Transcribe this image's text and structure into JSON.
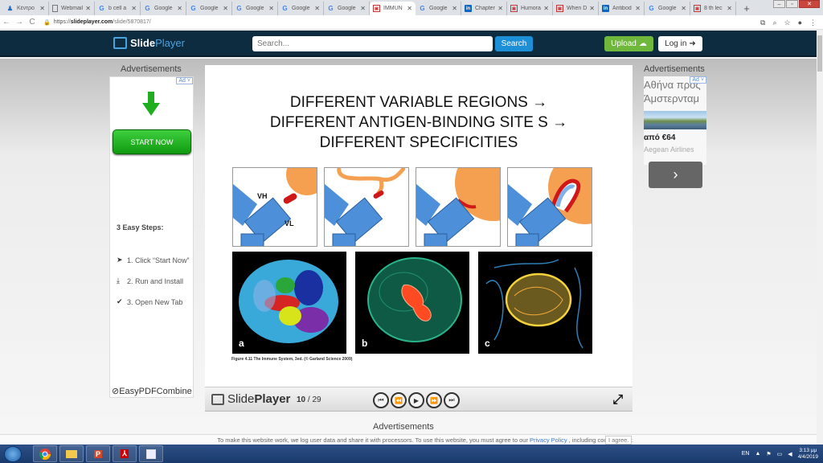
{
  "browser": {
    "tabs": [
      {
        "label": "Κέντρο",
        "favicon": "user-icon",
        "active": false
      },
      {
        "label": "Webmail",
        "favicon": "document-icon",
        "active": false
      },
      {
        "label": "b cell a",
        "favicon": "google-icon",
        "active": false
      },
      {
        "label": "Google",
        "favicon": "google-icon",
        "active": false
      },
      {
        "label": "Google",
        "favicon": "google-icon",
        "active": false
      },
      {
        "label": "Google",
        "favicon": "google-icon",
        "active": false
      },
      {
        "label": "Google",
        "favicon": "google-icon",
        "active": false
      },
      {
        "label": "Google",
        "favicon": "google-icon",
        "active": false
      },
      {
        "label": "IMMUN",
        "favicon": "slideplayer-icon",
        "active": true
      },
      {
        "label": "Google",
        "favicon": "google-icon",
        "active": false
      },
      {
        "label": "Chapter",
        "favicon": "linkedin-icon",
        "active": false
      },
      {
        "label": "Humora",
        "favicon": "slideplayer-icon",
        "active": false
      },
      {
        "label": "When D",
        "favicon": "slideplayer-icon",
        "active": false
      },
      {
        "label": "Antibod",
        "favicon": "linkedin-icon",
        "active": false
      },
      {
        "label": "Google",
        "favicon": "google-icon",
        "active": false
      },
      {
        "label": "8 th lec",
        "favicon": "slideplayer-icon",
        "active": false
      }
    ],
    "url_scheme": "https://",
    "url_host": "slideplayer.com",
    "url_path": "/slide/5870817/"
  },
  "site": {
    "logo_slide": "Slide",
    "logo_player": "Player",
    "search_placeholder": "Search...",
    "search_button": "Search",
    "upload_button": "Upload",
    "login_button": "Log in"
  },
  "left_ad": {
    "heading": "Advertisements",
    "badge": "Ad ˅",
    "cta": "START NOW",
    "steps_title": "3 Easy Steps:",
    "steps": [
      "1. Click “Start Now”",
      "2. Run and Install",
      "3. Open New Tab"
    ],
    "brand": "EasyPDFCombine"
  },
  "slide": {
    "title_lines": [
      "DIFFERENT VARIABLE REGIONS  →",
      "DIFFERENT ANTIGEN-BINDING SITE S →",
      "DIFFERENT SPECIFICITIES"
    ],
    "vh_label": "VH",
    "vl_label": "VL",
    "molecule_labels": [
      "a",
      "b",
      "c"
    ],
    "caption": "Figure 4.11 The Immune System, 3ed. (© Garland Science 2009)"
  },
  "player": {
    "logo_slide": "Slide",
    "logo_player": "Player",
    "current_page": "10",
    "separator": " / ",
    "total_pages": "29",
    "controls": [
      "first-slide",
      "previous-slide",
      "play",
      "next-slide",
      "last-slide"
    ]
  },
  "bottom_ad": {
    "heading": "Advertisements"
  },
  "right_ad": {
    "heading": "Advertisements",
    "badge": "Ad ˅",
    "headline_1": "Αθήνα προς",
    "headline_2": "Άμστερνταμ",
    "price": "από €64",
    "advertiser": "Aegean Airlines"
  },
  "cookie_bar": {
    "text_before": "To make this website work, we log user data and share it with processors. To use this website, you must agree to our",
    "link": "Privacy Policy",
    "text_after": ", including cookie policy.",
    "agree": "I agree."
  },
  "taskbar": {
    "apps": [
      "chrome",
      "file-explorer",
      "powerpoint",
      "acrobat",
      "window"
    ],
    "language": "EN",
    "time": "3:13 μμ",
    "date": "4/4/2019"
  }
}
